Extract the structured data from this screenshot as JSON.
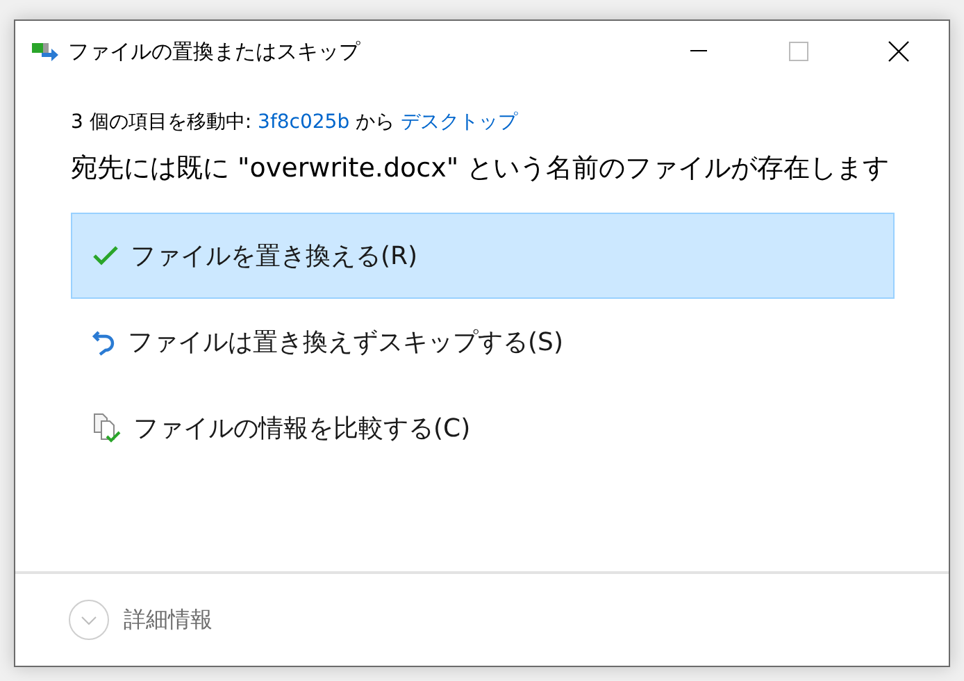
{
  "window": {
    "title": "ファイルの置換またはスキップ"
  },
  "status": [
    {
      "kind": "text",
      "text": "3 個の項目を移動中: "
    },
    {
      "kind": "link",
      "text": "3f8c025b"
    },
    {
      "kind": "text",
      "text": " から "
    },
    {
      "kind": "link",
      "text": "デスクトップ"
    }
  ],
  "heading": "宛先には既に \"overwrite.docx\" という名前のファイルが存在します",
  "options": [
    {
      "kind": "replace",
      "label": "ファイルを置き換える(R)",
      "selected": true
    },
    {
      "kind": "skip",
      "label": "ファイルは置き換えずスキップする(S)",
      "selected": false
    },
    {
      "kind": "compare",
      "label": "ファイルの情報を比較する(C)",
      "selected": false
    }
  ],
  "footer": {
    "label": "詳細情報"
  }
}
